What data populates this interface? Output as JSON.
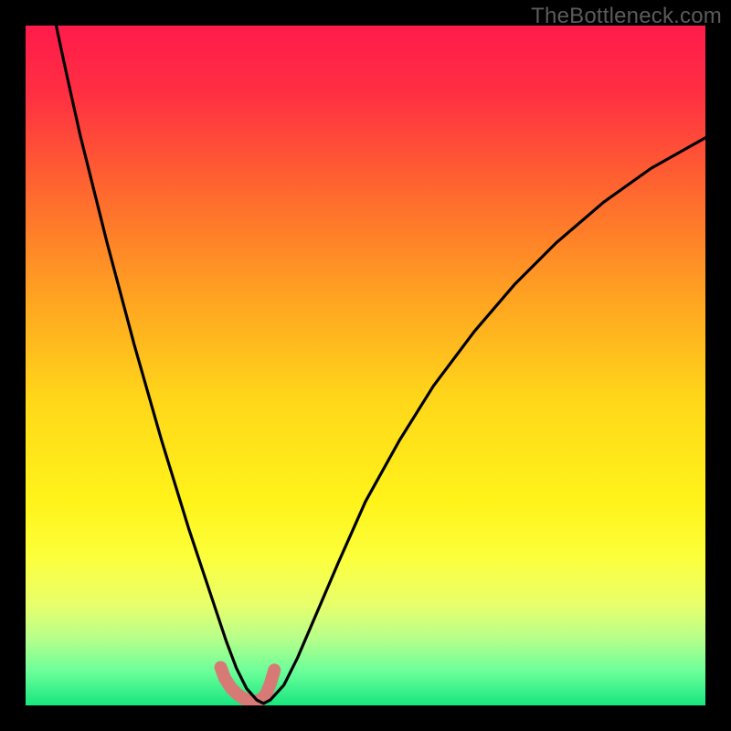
{
  "watermark": "TheBottleneck.com",
  "chart_data": {
    "type": "line",
    "title": "",
    "xlabel": "",
    "ylabel": "",
    "xlim": [
      0,
      100
    ],
    "ylim": [
      0,
      100
    ],
    "note": "Axis values are normalized percentages (0–100) estimated from pixel positions; the source image has no tick labels.",
    "gradient_stops": [
      {
        "offset": 0.0,
        "color": "#ff1b4b"
      },
      {
        "offset": 0.1,
        "color": "#ff2f42"
      },
      {
        "offset": 0.25,
        "color": "#ff6a2e"
      },
      {
        "offset": 0.4,
        "color": "#ffa321"
      },
      {
        "offset": 0.55,
        "color": "#ffd71a"
      },
      {
        "offset": 0.7,
        "color": "#fff31a"
      },
      {
        "offset": 0.78,
        "color": "#fcff3a"
      },
      {
        "offset": 0.85,
        "color": "#e9ff6a"
      },
      {
        "offset": 0.9,
        "color": "#b8ff8a"
      },
      {
        "offset": 0.95,
        "color": "#6bff9a"
      },
      {
        "offset": 1.0,
        "color": "#18e67e"
      }
    ],
    "series": [
      {
        "name": "bottleneck-curve",
        "stroke": "#000000",
        "x": [
          4.5,
          6,
          8,
          10,
          12,
          14,
          16,
          18,
          20,
          22,
          24,
          26,
          28,
          29.5,
          31,
          32.5,
          34,
          35,
          36,
          38,
          40,
          43,
          46,
          50,
          55,
          60,
          66,
          72,
          78,
          85,
          92,
          100
        ],
        "y": [
          100,
          93,
          84,
          76,
          68,
          60.5,
          53,
          46,
          39,
          32.5,
          26,
          20,
          14,
          9.5,
          5.5,
          2.5,
          0.8,
          0.3,
          0.8,
          3,
          7,
          14,
          21,
          30,
          39,
          47,
          55,
          62,
          68,
          74,
          79,
          83.5
        ]
      },
      {
        "name": "highlight-segment",
        "stroke": "#d77a76",
        "x": [
          28.7,
          29.3,
          30.2,
          31.2,
          32.3,
          33.5,
          34.6,
          35.4,
          36.0,
          36.6
        ],
        "y": [
          5.6,
          4.0,
          2.6,
          1.6,
          0.9,
          0.6,
          0.8,
          1.7,
          3.2,
          5.2
        ]
      }
    ]
  }
}
